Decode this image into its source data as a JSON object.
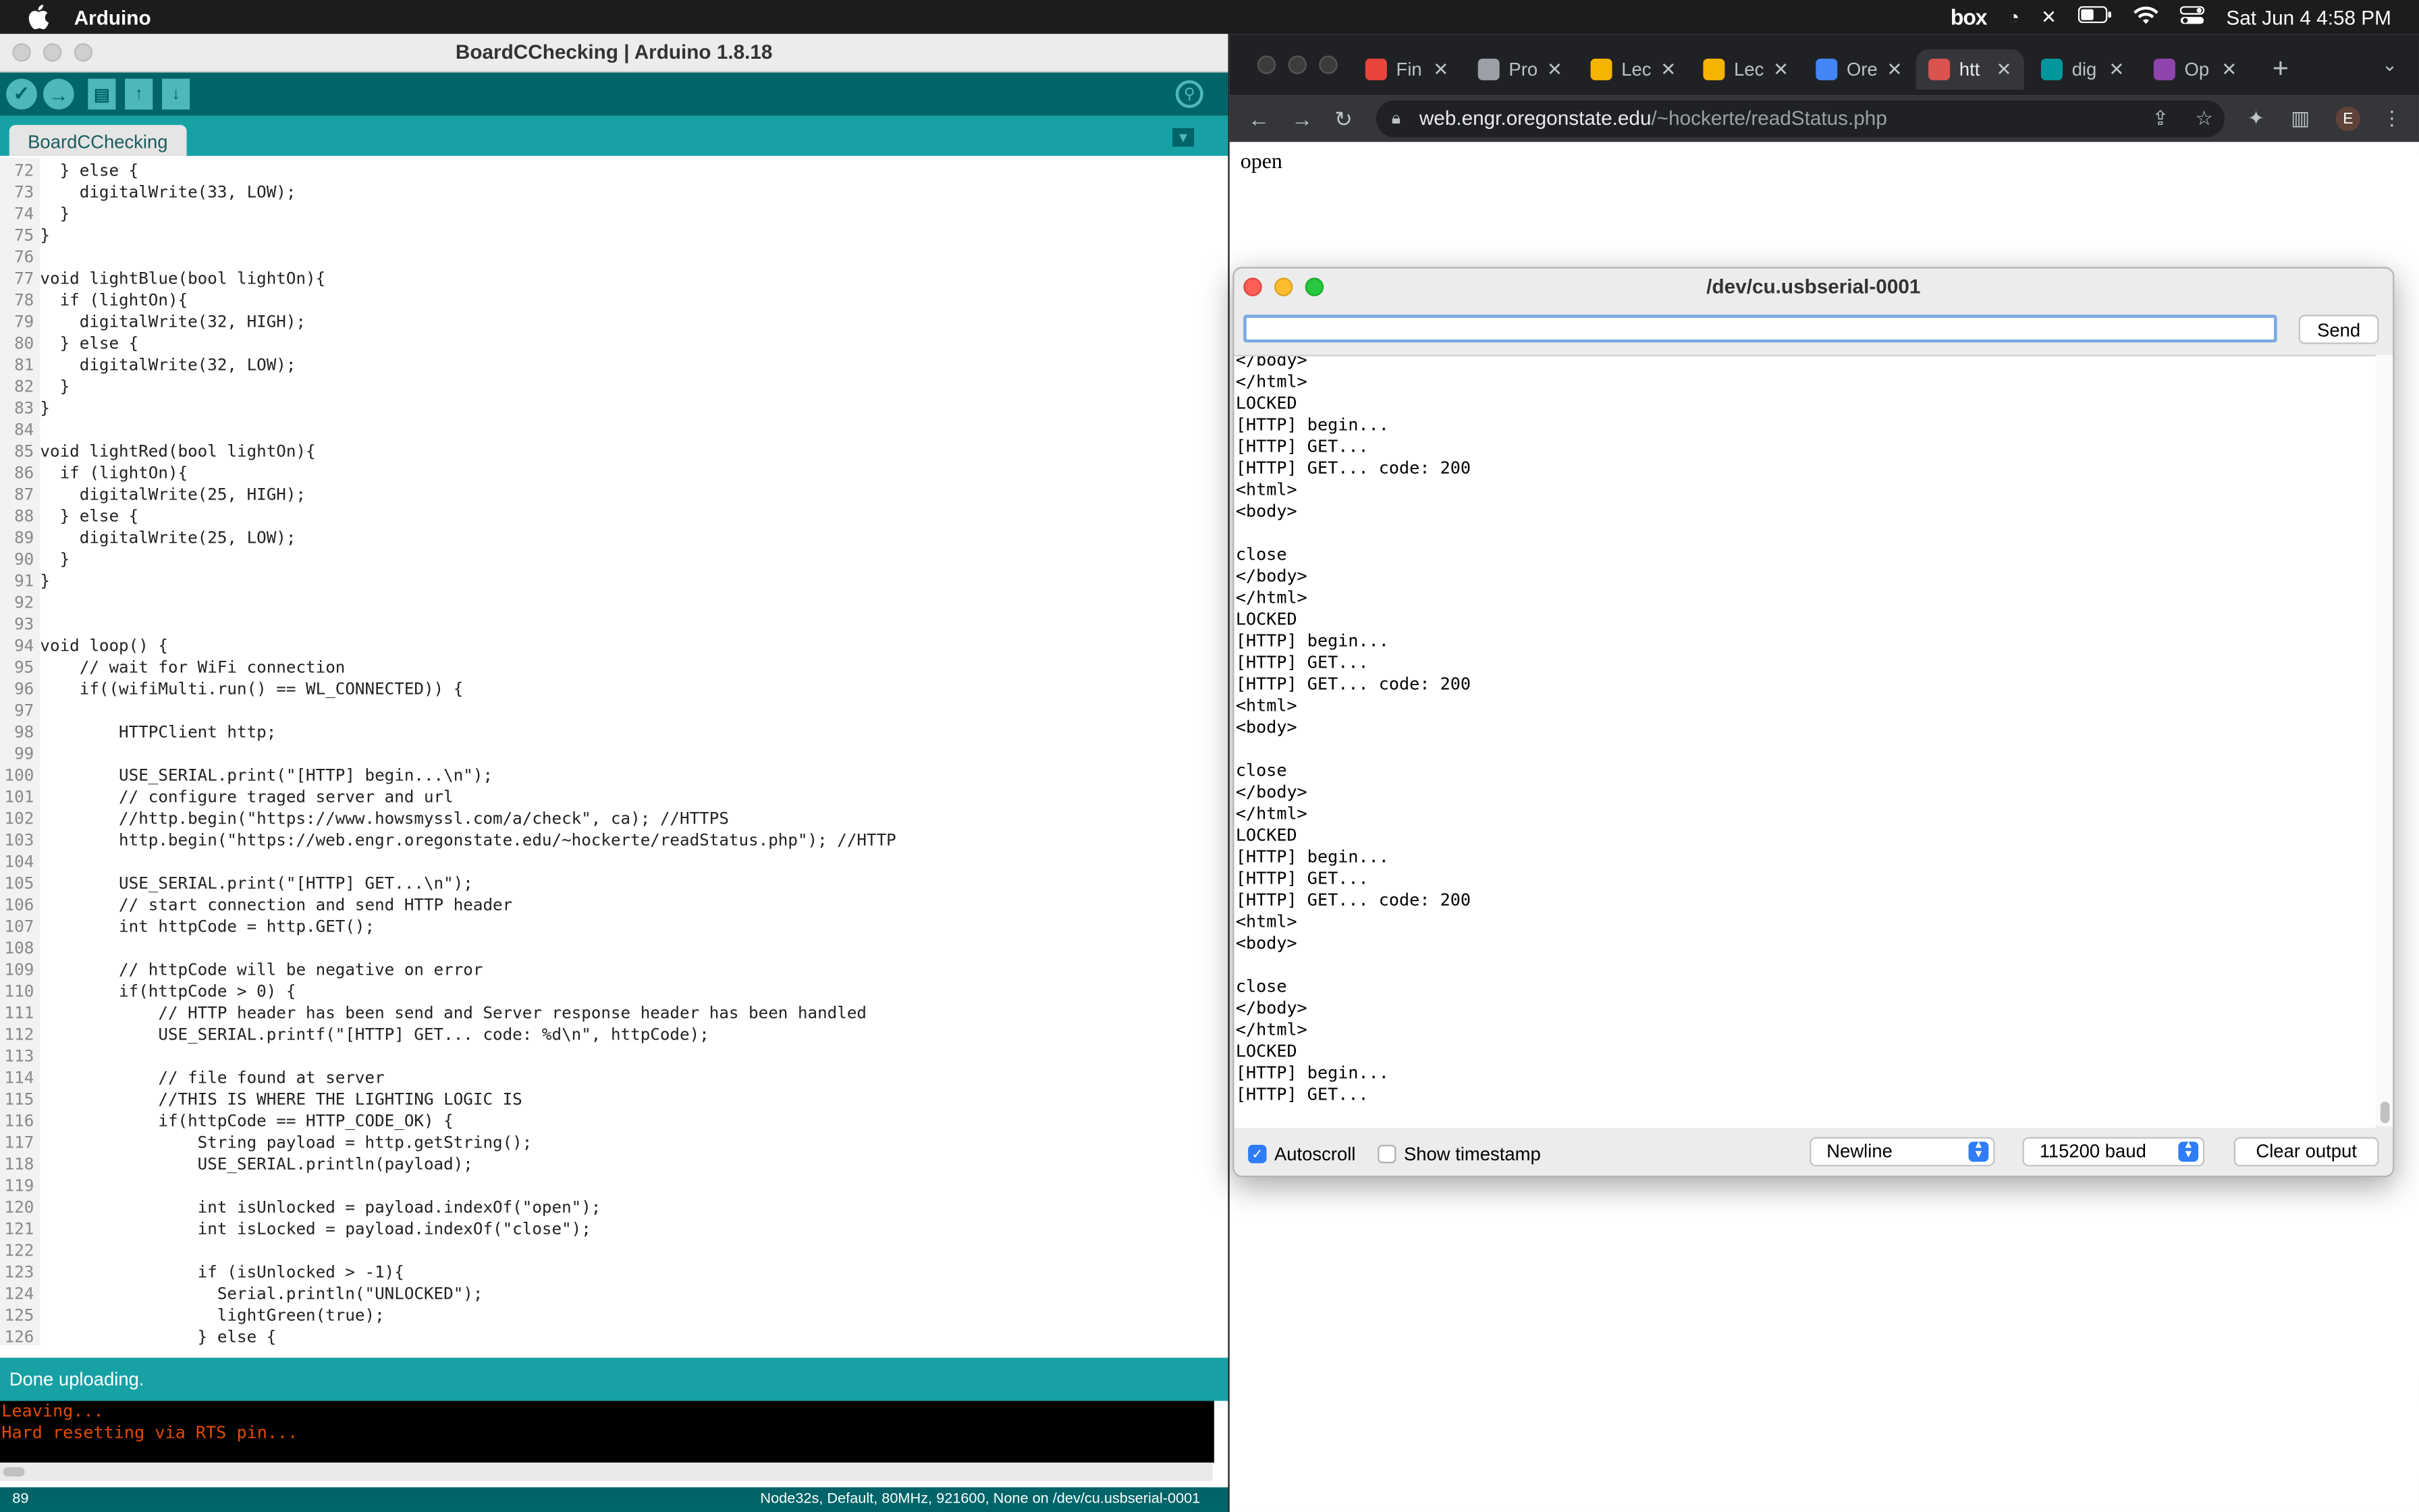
{
  "menubar": {
    "app_name": "Arduino",
    "box_label": "box",
    "datetime": "Sat Jun 4  4:58 PM"
  },
  "arduino": {
    "window_title": "BoardCChecking | Arduino 1.8.18",
    "tab_label": "BoardCChecking",
    "status": "Done uploading.",
    "console_lines": [
      "Leaving...",
      "Hard resetting via RTS pin..."
    ],
    "footer_line": "89",
    "footer_board": "Node32s, Default, 80MHz, 921600, None on /dev/cu.usbserial-0001",
    "code": [
      {
        "n": "72",
        "t": "  } else {"
      },
      {
        "n": "73",
        "t": "    digitalWrite(33, LOW);"
      },
      {
        "n": "74",
        "t": "  }"
      },
      {
        "n": "75",
        "t": "}"
      },
      {
        "n": "76",
        "t": ""
      },
      {
        "n": "77",
        "t": "void lightBlue(bool lightOn){"
      },
      {
        "n": "78",
        "t": "  if (lightOn){"
      },
      {
        "n": "79",
        "t": "    digitalWrite(32, HIGH);"
      },
      {
        "n": "80",
        "t": "  } else {"
      },
      {
        "n": "81",
        "t": "    digitalWrite(32, LOW);"
      },
      {
        "n": "82",
        "t": "  }"
      },
      {
        "n": "83",
        "t": "}"
      },
      {
        "n": "84",
        "t": ""
      },
      {
        "n": "85",
        "t": "void lightRed(bool lightOn){"
      },
      {
        "n": "86",
        "t": "  if (lightOn){"
      },
      {
        "n": "87",
        "t": "    digitalWrite(25, HIGH);"
      },
      {
        "n": "88",
        "t": "  } else {"
      },
      {
        "n": "89",
        "t": "    digitalWrite(25, LOW);"
      },
      {
        "n": "90",
        "t": "  }"
      },
      {
        "n": "91",
        "t": "}"
      },
      {
        "n": "92",
        "t": ""
      },
      {
        "n": "93",
        "t": ""
      },
      {
        "n": "94",
        "t": "void loop() {"
      },
      {
        "n": "95",
        "t": "    // wait for WiFi connection"
      },
      {
        "n": "96",
        "t": "    if((wifiMulti.run() == WL_CONNECTED)) {"
      },
      {
        "n": "97",
        "t": ""
      },
      {
        "n": "98",
        "t": "        HTTPClient http;"
      },
      {
        "n": "99",
        "t": ""
      },
      {
        "n": "100",
        "t": "        USE_SERIAL.print(\"[HTTP] begin...\\n\");"
      },
      {
        "n": "101",
        "t": "        // configure traged server and url"
      },
      {
        "n": "102",
        "t": "        //http.begin(\"https://www.howsmyssl.com/a/check\", ca); //HTTPS"
      },
      {
        "n": "103",
        "t": "        http.begin(\"https://web.engr.oregonstate.edu/~hockerte/readStatus.php\"); //HTTP"
      },
      {
        "n": "104",
        "t": ""
      },
      {
        "n": "105",
        "t": "        USE_SERIAL.print(\"[HTTP] GET...\\n\");"
      },
      {
        "n": "106",
        "t": "        // start connection and send HTTP header"
      },
      {
        "n": "107",
        "t": "        int httpCode = http.GET();"
      },
      {
        "n": "108",
        "t": ""
      },
      {
        "n": "109",
        "t": "        // httpCode will be negative on error"
      },
      {
        "n": "110",
        "t": "        if(httpCode > 0) {"
      },
      {
        "n": "111",
        "t": "            // HTTP header has been send and Server response header has been handled"
      },
      {
        "n": "112",
        "t": "            USE_SERIAL.printf(\"[HTTP] GET... code: %d\\n\", httpCode);"
      },
      {
        "n": "113",
        "t": ""
      },
      {
        "n": "114",
        "t": "            // file found at server"
      },
      {
        "n": "115",
        "t": "            //THIS IS WHERE THE LIGHTING LOGIC IS"
      },
      {
        "n": "116",
        "t": "            if(httpCode == HTTP_CODE_OK) {"
      },
      {
        "n": "117",
        "t": "                String payload = http.getString();"
      },
      {
        "n": "118",
        "t": "                USE_SERIAL.println(payload);"
      },
      {
        "n": "119",
        "t": ""
      },
      {
        "n": "120",
        "t": "                int isUnlocked = payload.indexOf(\"open\");"
      },
      {
        "n": "121",
        "t": "                int isLocked = payload.indexOf(\"close\");"
      },
      {
        "n": "122",
        "t": ""
      },
      {
        "n": "123",
        "t": "                if (isUnlocked > -1){"
      },
      {
        "n": "124",
        "t": "                  Serial.println(\"UNLOCKED\");"
      },
      {
        "n": "125",
        "t": "                  lightGreen(true);"
      },
      {
        "n": "126",
        "t": "                } else {"
      }
    ]
  },
  "browser": {
    "tabs": [
      {
        "label": "Fin",
        "color": "#e8453c"
      },
      {
        "label": "Pro",
        "color": "#9aa0a6"
      },
      {
        "label": "Lec",
        "color": "#f4b400"
      },
      {
        "label": "Lec",
        "color": "#f4b400"
      },
      {
        "label": "Ore",
        "color": "#4285f4"
      },
      {
        "label": "htt",
        "color": "#d9534f"
      },
      {
        "label": "dig",
        "color": "#00979c"
      },
      {
        "label": "Op",
        "color": "#8e44ad"
      }
    ],
    "url_host": "web.engr.oregonstate.edu",
    "url_path": "/~hockerte/readStatus.php",
    "avatar_letter": "E",
    "page_text": "open"
  },
  "serial_monitor": {
    "title": "/dev/cu.usbserial-0001",
    "input_value": "",
    "send_label": "Send",
    "output": [
      "</body>",
      "</html>",
      "LOCKED",
      "[HTTP] begin...",
      "[HTTP] GET...",
      "[HTTP] GET... code: 200",
      "<html>",
      "<body>",
      "",
      "close",
      "</body>",
      "</html>",
      "LOCKED",
      "[HTTP] begin...",
      "[HTTP] GET...",
      "[HTTP] GET... code: 200",
      "<html>",
      "<body>",
      "",
      "close",
      "</body>",
      "</html>",
      "LOCKED",
      "[HTTP] begin...",
      "[HTTP] GET...",
      "[HTTP] GET... code: 200",
      "<html>",
      "<body>",
      "",
      "close",
      "</body>",
      "</html>",
      "LOCKED",
      "[HTTP] begin...",
      "[HTTP] GET..."
    ],
    "autoscroll_label": "Autoscroll",
    "autoscroll_checked": true,
    "timestamp_label": "Show timestamp",
    "timestamp_checked": false,
    "line_ending": "Newline",
    "baud": "115200 baud",
    "clear_label": "Clear output"
  }
}
